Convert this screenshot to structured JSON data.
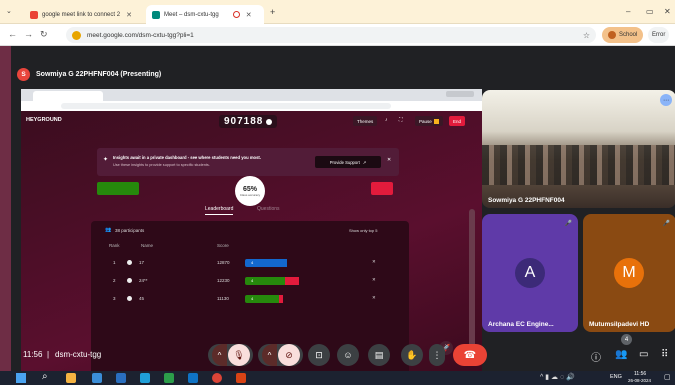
{
  "browser": {
    "tab1": "google meet link to connect 2",
    "tab2": "Meet – dsm-cxtu-tgg",
    "new_tab": "+",
    "minimize": "–",
    "restore": "▭",
    "close": "✕",
    "url": "meet.google.com/dsm-cxtu-tgg?pli=1",
    "profile1": "School",
    "profile2": "Error"
  },
  "meet": {
    "presenter_initial": "S",
    "presenter_label": "Sowmiya G 22PHFNF004 (Presenting)",
    "meeting_time": "11:56",
    "meeting_code": "dsm-cxtu-tgg",
    "participant_count": "4",
    "tiles": [
      {
        "name": "Sowmiya G 22PHFNF004"
      },
      {
        "name": "Archana EC Engine...",
        "initial": "A"
      },
      {
        "name": "Mutumsilpadevi HD",
        "initial": "M"
      }
    ]
  },
  "shared": {
    "brand": "HEYGROUND",
    "game_pin": "907188",
    "themes_label": "Themes",
    "pause_label": "Pause",
    "end_label": "End",
    "banner_title": "Insights await in a private dashboard - see where students need you most.",
    "banner_sub": "Use these insights to provide support to specific students.",
    "provide_support": "Provide Support",
    "percent": "65%",
    "percent_sub": "Class accuracy",
    "tab_leaderboard": "Leaderboard",
    "tab_questions": "Questions",
    "participants": "38 participants",
    "show_only": "Show only top 5",
    "col_rank": "Rank",
    "col_name": "Name",
    "col_score": "Score",
    "rows": [
      {
        "rank": "1",
        "name": "17",
        "score": "12870",
        "badge": "4"
      },
      {
        "rank": "2",
        "name": "24**",
        "score": "12230",
        "badge": "4"
      },
      {
        "rank": "3",
        "name": "45",
        "score": "11130",
        "badge": "4"
      }
    ]
  },
  "taskbar": {
    "lang": "ENG",
    "time": "11:56",
    "date": "26-08-2024"
  }
}
